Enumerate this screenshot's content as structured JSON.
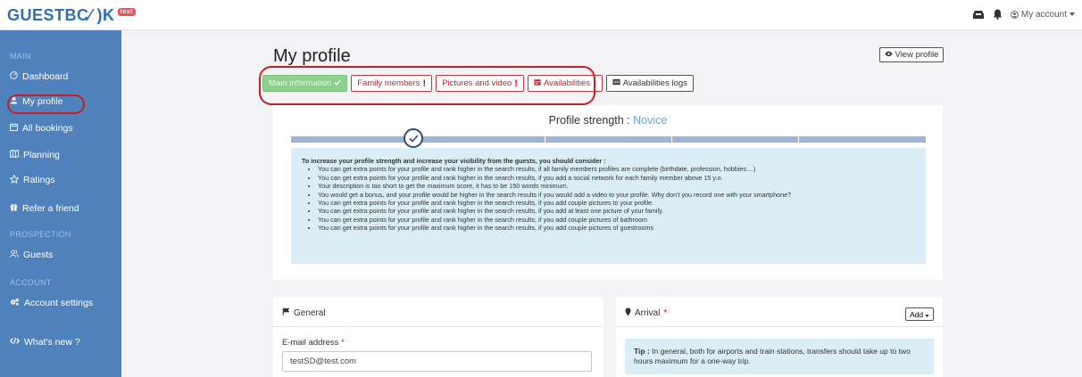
{
  "brand": {
    "logo_text": "GUESTBC⁄ )K",
    "badge": "test",
    "accent": "#2f6fb4"
  },
  "topbar": {
    "account_label": "My account"
  },
  "sidebar": {
    "sections": {
      "main": "MAIN",
      "prospection": "PROSPECTION",
      "account": "ACCOUNT"
    },
    "items": [
      {
        "label": "Dashboard",
        "icon": "dashboard-icon"
      },
      {
        "label": "My profile",
        "icon": "user-icon",
        "active": true
      },
      {
        "label": "All bookings",
        "icon": "calendar-icon"
      },
      {
        "label": "Planning",
        "icon": "planning-icon"
      },
      {
        "label": "Ratings",
        "icon": "star-icon"
      },
      {
        "label": "Refer a friend",
        "icon": "gift-icon"
      },
      {
        "label": "Guests",
        "icon": "users-icon"
      },
      {
        "label": "Account settings",
        "icon": "cogs-icon"
      },
      {
        "label": "What's new ?",
        "icon": "code-icon"
      }
    ]
  },
  "page": {
    "title": "My profile",
    "view_profile": "View profile"
  },
  "tabs": [
    {
      "label": "Main information",
      "state": "complete"
    },
    {
      "label": "Family members",
      "state": "incomplete"
    },
    {
      "label": "Pictures and video",
      "state": "incomplete"
    },
    {
      "label": "Availabilities",
      "state": "incomplete"
    },
    {
      "label": "Availabilities logs",
      "state": "neutral"
    }
  ],
  "strength": {
    "title": "Profile strength : ",
    "level": "Novice",
    "progress_steps": 5,
    "progress_current": 1,
    "heading": "To increase your profile strength and increase your visibility from the guests, you should consider :",
    "tips": [
      "You can get extra points for your profile and rank higher in the search results, if all family members profiles are complete (birthdate, profession, hobbies....)",
      "You can get extra points for your profile and rank higher in the search results, if you add a social network for each family member above 15 y.o.",
      "Your description is too short to get the maximum score, it has to be 150 words minimum.",
      "You would get a bonus, and your profile would be higher in the search results if you would add a video to your profile. Why don't you record one with your smartphone?",
      "You can get extra points for your profile and rank higher in the search results, if you add couple pictures to your profile.",
      "You can get extra points for your profile and rank higher in the search results, if you add at least one picture of your family.",
      "You can get extra points for your profile and rank higher in the search results, if you add couple pictures of bathroom",
      "You can get extra points for your profile and rank higher in the search results, if you add couple pictures of guestrooms"
    ]
  },
  "general": {
    "title": "General",
    "email_label": "E-mail address",
    "email_value": "testSD@test.com"
  },
  "arrival": {
    "title": "Arrival",
    "add_label": "Add",
    "tip_bold": "Tip :",
    "tip_text": " In general, both for airports and train stations, transfers should take up to two hours maximum for a one-way trip."
  }
}
